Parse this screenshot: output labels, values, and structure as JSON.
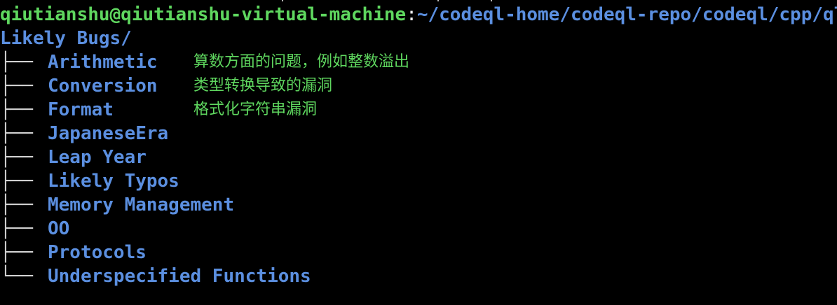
{
  "prompt": {
    "user_host": "qiutianshu@qiutianshu-virtual-machine",
    "separator": ":",
    "path": "~/codeql-home/codeql-repo/codeql/cpp/ql/src/"
  },
  "directory": "Likely Bugs/",
  "tree": {
    "branch": "├──",
    "last_branch": "└──",
    "items": [
      {
        "name": "Arithmetic",
        "comment": "算数方面的问题，例如整数溢出"
      },
      {
        "name": "Conversion",
        "comment": "类型转换导致的漏洞"
      },
      {
        "name": "Format",
        "comment": "格式化字符串漏洞"
      },
      {
        "name": "JapaneseEra",
        "comment": ""
      },
      {
        "name": "Leap Year",
        "comment": ""
      },
      {
        "name": "Likely Typos",
        "comment": ""
      },
      {
        "name": "Memory Management",
        "comment": ""
      },
      {
        "name": "OO",
        "comment": ""
      },
      {
        "name": "Protocols",
        "comment": ""
      },
      {
        "name": "Underspecified Functions",
        "comment": ""
      }
    ]
  },
  "colors": {
    "background": "#000000",
    "green": "#5fd75f",
    "blue": "#5b8fe0",
    "tree_lines": "#d0d0d0"
  }
}
